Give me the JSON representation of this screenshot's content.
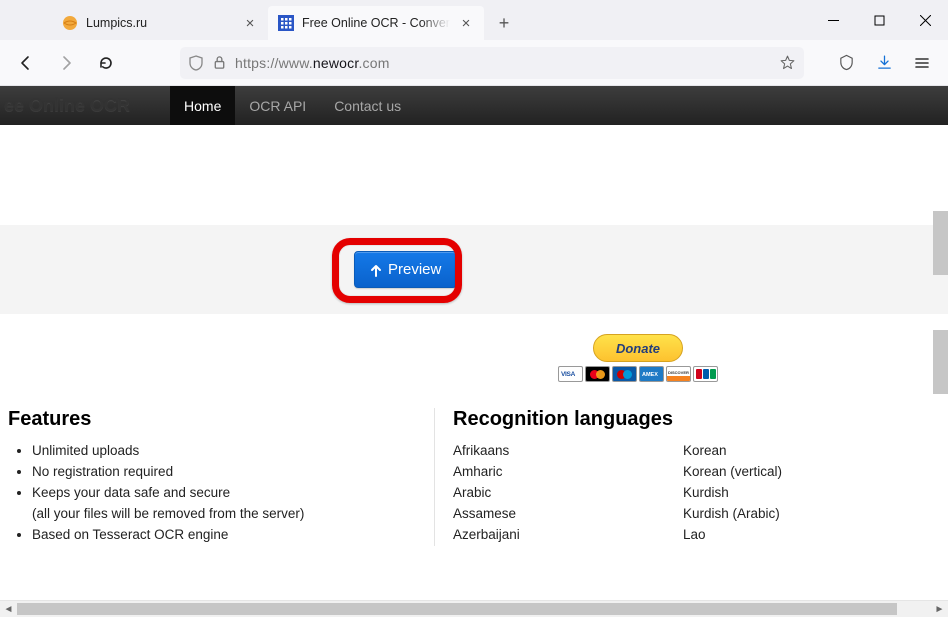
{
  "tabs": [
    {
      "title": "Lumpics.ru",
      "favicon": "lumpics"
    },
    {
      "title": "Free Online OCR - Convert JPEG",
      "favicon": "newocr"
    }
  ],
  "url": {
    "scheme": "https://",
    "prefix": "www.",
    "domain": "newocr",
    "suffix": ".com"
  },
  "site": {
    "title": "ee Online OCR",
    "nav": [
      {
        "label": "Home",
        "active": true
      },
      {
        "label": "OCR API",
        "active": false
      },
      {
        "label": "Contact us",
        "active": false
      }
    ]
  },
  "preview": {
    "label": "Preview"
  },
  "donate": {
    "label": "Donate"
  },
  "features": {
    "heading": "Features",
    "items": [
      "Unlimited uploads",
      "No registration required",
      "Keeps your data safe and secure",
      "(all your files will be removed from the server)",
      "Based on Tesseract OCR engine"
    ]
  },
  "recognition": {
    "heading": "Recognition languages",
    "col1": [
      "Afrikaans",
      "Amharic",
      "Arabic",
      "Assamese",
      "Azerbaijani"
    ],
    "col2": [
      "Korean",
      "Korean (vertical)",
      "Kurdish",
      "Kurdish (Arabic)",
      "Lao"
    ]
  }
}
